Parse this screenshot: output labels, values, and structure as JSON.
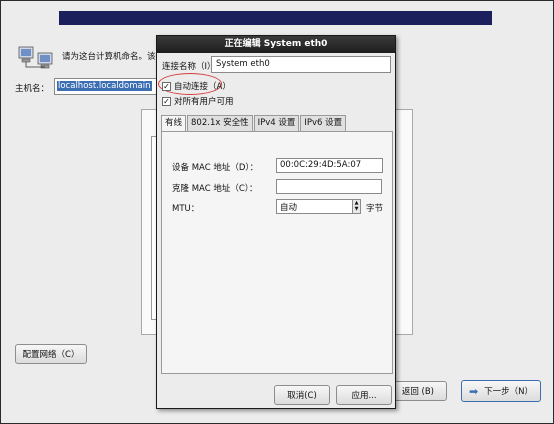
{
  "installer": {
    "prompt": "请为这台计算机命名。该",
    "hostname_label": "主机名：",
    "hostname_value": "localhost.localdomain",
    "configure_network_label": "配置网络（C）",
    "back_label": "返回 (B)",
    "next_label": "下一步（N）"
  },
  "dialog": {
    "title": "正在编辑 System eth0",
    "connection_name_label": "连接名称（I）",
    "connection_name_value": "System eth0",
    "auto_connect_label": "自动连接（A）",
    "all_users_label": "对所有用户可用",
    "auto_connect_checked": true,
    "all_users_checked": true,
    "tabs": [
      {
        "label": "有线",
        "active": true
      },
      {
        "label": "802.1x 安全性",
        "active": false
      },
      {
        "label": "IPv4 设置",
        "active": false
      },
      {
        "label": "IPv6 设置",
        "active": false
      }
    ],
    "wired": {
      "device_mac_label": "设备 MAC 地址（D）：",
      "device_mac_value": "00:0C:29:4D:5A:07",
      "cloned_mac_label": "克隆 MAC 地址（C）：",
      "cloned_mac_value": "",
      "mtu_label": "MTU：",
      "mtu_value": "自动",
      "mtu_unit": "字节"
    },
    "cancel_label": "取消(C)",
    "apply_label": "应用..."
  },
  "colors": {
    "banner": "#1b1f5c",
    "selection": "#3c6eb4",
    "annotation_circle": "#d43c3c"
  },
  "icons": {
    "network": "network-computers-icon",
    "next_arrow": "arrow-right-icon",
    "checkbox": "checkmark-icon"
  }
}
